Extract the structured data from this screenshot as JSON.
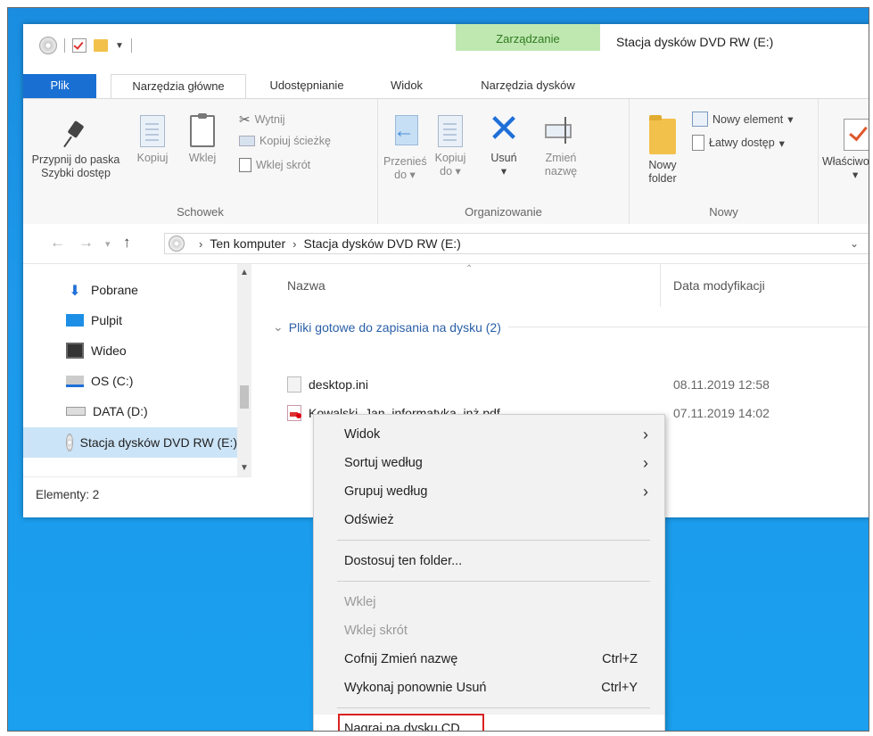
{
  "window": {
    "title": "Stacja dysków DVD RW (E:)",
    "context_group": "Zarządzanie",
    "status": "Elementy: 2"
  },
  "tabs": {
    "file": "Plik",
    "home": "Narzędzia główne",
    "share": "Udostępnianie",
    "view": "Widok",
    "drive_tools": "Narzędzia dysków"
  },
  "ribbon": {
    "pin_line1": "Przypnij do paska",
    "pin_line2": "Szybki dostęp",
    "copy": "Kopiuj",
    "paste": "Wklej",
    "cut": "Wytnij",
    "copy_path": "Kopiuj ścieżkę",
    "paste_shortcut": "Wklej skrót",
    "clipboard_group": "Schowek",
    "move_line1": "Przenieś",
    "move_line2": "do",
    "copyto_line1": "Kopiuj",
    "copyto_line2": "do",
    "delete": "Usuń",
    "rename_line1": "Zmień",
    "rename_line2": "nazwę",
    "organize_group": "Organizowanie",
    "newfolder_line1": "Nowy",
    "newfolder_line2": "folder",
    "new_item": "Nowy element",
    "easy_access": "Łatwy dostęp",
    "new_group": "Nowy",
    "properties": "Właściwości"
  },
  "address": {
    "crumb1": "Ten komputer",
    "crumb2": "Stacja dysków DVD RW (E:)"
  },
  "nav": {
    "items": [
      {
        "label": "Pobrane"
      },
      {
        "label": "Pulpit"
      },
      {
        "label": "Wideo"
      },
      {
        "label": "OS (C:)"
      },
      {
        "label": "DATA (D:)"
      },
      {
        "label": "Stacja dysków DVD RW (E:)"
      }
    ]
  },
  "content": {
    "col_name": "Nazwa",
    "col_date": "Data modyfikacji",
    "group": "Pliki gotowe do zapisania na dysku (2)",
    "files": [
      {
        "name": "desktop.ini",
        "date": "08.11.2019 12:58"
      },
      {
        "name": "Kowalski_Jan_informatyka_inż.pdf",
        "date": "07.11.2019 14:02"
      }
    ]
  },
  "menu": {
    "view": "Widok",
    "sort": "Sortuj według",
    "group": "Grupuj według",
    "refresh": "Odśwież",
    "customize": "Dostosuj ten folder...",
    "paste": "Wklej",
    "paste_shortcut": "Wklej skrót",
    "undo": "Cofnij Zmień nazwę",
    "undo_sc": "Ctrl+Z",
    "redo": "Wykonaj ponownie Usuń",
    "redo_sc": "Ctrl+Y",
    "burn": "Nagraj na dysku CD"
  },
  "colors": {
    "file_tab": "#1a6fd3",
    "context_tab": "#bfe8b1",
    "highlight_box": "#d92222",
    "desktop": "#1d98ea"
  }
}
